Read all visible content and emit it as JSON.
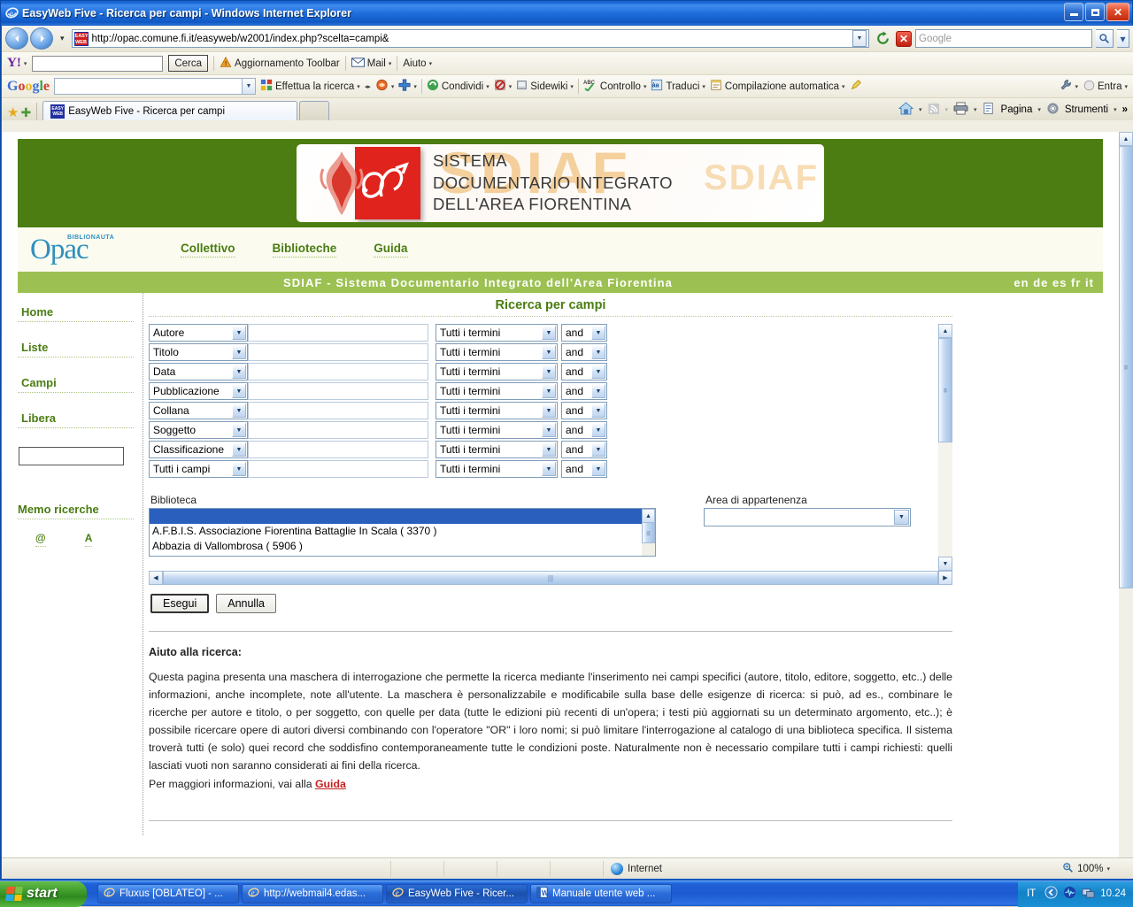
{
  "window": {
    "title": "EasyWeb Five - Ricerca per campi - Windows Internet Explorer",
    "minimize": "_",
    "maximize": "❐",
    "close": "✕"
  },
  "browser": {
    "back_icon": "◀",
    "forward_icon": "▶",
    "history_caret": "▾",
    "url": "http://opac.comune.fi.it/easyweb/w2001/index.php?scelta=campi&",
    "url_favicon_text": "EASY WEB",
    "refresh_icon": "↻",
    "stop_icon": "✕",
    "search_placeholder": "Google",
    "search_icon": "🔍",
    "search_caret": "▾"
  },
  "yahoo_toolbar": {
    "logo": "Y!",
    "caret": "▾",
    "input_value": "",
    "search_button": "Cerca",
    "items": [
      {
        "label": "Aggiornamento Toolbar",
        "icon": "warning-icon",
        "caret": false
      },
      {
        "label": "Mail",
        "icon": "mail-icon",
        "caret": true
      },
      {
        "label": "Aiuto",
        "icon": "",
        "caret": true
      }
    ]
  },
  "google_toolbar": {
    "logo": "Google",
    "input_value": "",
    "items": [
      {
        "label": "Effettua la ricerca",
        "icon": "google-search-icon",
        "caret": true
      },
      {
        "label": "",
        "icon": "bookmark-icon",
        "caret": true
      },
      {
        "label": "",
        "icon": "plus-icon",
        "caret": true
      },
      {
        "label": "Condividi",
        "icon": "share-icon",
        "caret": true
      },
      {
        "label": "",
        "icon": "blocked-icon",
        "caret": true
      },
      {
        "label": "Sidewiki",
        "icon": "sidewiki-icon",
        "caret": true
      },
      {
        "label": "Controllo",
        "icon": "spellcheck-icon",
        "caret": true
      },
      {
        "label": "Traduci",
        "icon": "translate-icon",
        "caret": true
      },
      {
        "label": "Compilazione automatica",
        "icon": "autofill-icon",
        "caret": true
      },
      {
        "label": "",
        "icon": "highlighter-icon",
        "caret": false
      }
    ],
    "right_items": [
      {
        "label": "",
        "icon": "wrench-icon",
        "caret": true
      },
      {
        "label": "Entra",
        "icon": "account-icon",
        "caret": true
      }
    ]
  },
  "tabs": {
    "favorites_icon": "★",
    "add_favorite_icon": "✚",
    "items": [
      {
        "label": "EasyWeb Five - Ricerca per campi",
        "favicon": "EASY WEB",
        "active": true
      },
      {
        "label": "",
        "favicon": "",
        "active": false
      }
    ],
    "tools": [
      {
        "label": "",
        "icon": "home-icon",
        "caret": true
      },
      {
        "label": "",
        "icon": "feed-icon",
        "caret": true
      },
      {
        "label": "",
        "icon": "print-icon",
        "caret": true
      },
      {
        "label": "Pagina",
        "icon": "page-icon",
        "caret": true
      },
      {
        "label": "Strumenti",
        "icon": "gear-icon",
        "caret": true
      }
    ],
    "overflow": "»"
  },
  "page": {
    "banner": {
      "line1": "SISTEMA",
      "line2": "DOCUMENTARIO INTEGRATO",
      "line3": "DELL'AREA FIORENTINA",
      "watermark": "SDIAF",
      "watermark2": "SDIAF",
      "crest_letters": "Œ"
    },
    "opac": {
      "logo_main": "Opac",
      "logo_sub": "BIBLIONAUTA",
      "nav": [
        "Collettivo",
        "Biblioteche",
        "Guida"
      ]
    },
    "greenstrip": {
      "title": "SDIAF - Sistema Documentario Integrato dell'Area Fiorentina",
      "languages": "en de es fr it"
    },
    "sidebar": {
      "items": [
        "Home",
        "Liste",
        "Campi",
        "Libera"
      ],
      "quick_search_value": "",
      "memo_title": "Memo ricerche",
      "memo_icons": [
        "@",
        "A"
      ]
    },
    "main": {
      "title": "Ricerca per campi",
      "rows": [
        {
          "field": "Autore",
          "value": "",
          "mode": "Tutti i termini",
          "op": "and"
        },
        {
          "field": "Titolo",
          "value": "",
          "mode": "Tutti i termini",
          "op": "and"
        },
        {
          "field": "Data",
          "value": "",
          "mode": "Tutti i termini",
          "op": "and"
        },
        {
          "field": "Pubblicazione",
          "value": "",
          "mode": "Tutti i termini",
          "op": "and"
        },
        {
          "field": "Collana",
          "value": "",
          "mode": "Tutti i termini",
          "op": "and"
        },
        {
          "field": "Soggetto",
          "value": "",
          "mode": "Tutti i termini",
          "op": "and"
        },
        {
          "field": "Classificazione",
          "value": "",
          "mode": "Tutti i termini",
          "op": "and"
        },
        {
          "field": "Tutti i campi",
          "value": "",
          "mode": "Tutti i termini",
          "op": "and"
        }
      ],
      "biblioteca_label": "Biblioteca",
      "biblioteca_options": [
        "",
        "A.F.B.I.S. Associazione Fiorentina Battaglie In Scala ( 3370 )",
        "Abbazia di Vallombrosa ( 5906 )"
      ],
      "area_label": "Area di appartenenza",
      "area_value": "",
      "buttons": {
        "submit": "Esegui",
        "reset": "Annulla"
      },
      "help_title": "Aiuto alla ricerca:",
      "help_paragraph": "Questa pagina presenta una maschera di interrogazione che permette la ricerca mediante l'inserimento nei campi specifici (autore, titolo, editore, soggetto, etc..) delle informazioni, anche incomplete, note all'utente. La maschera è personalizzabile e modificabile sulla base delle esigenze di ricerca: si può, ad es., combinare le ricerche per autore e titolo, o per soggetto, con quelle per data (tutte le edizioni più recenti di un'opera; i testi più aggiornati su un determinato argomento, etc..); è possibile ricercare opere di autori diversi combinando con l'operatore \"OR\" i loro nomi; si può limitare l'interrogazione al catalogo di una biblioteca specifica. Il sistema troverà tutti (e solo) quei record che soddisfino contemporaneamente tutte le condizioni poste. Naturalmente non è necessario compilare tutti i campi richiesti: quelli lasciati vuoti non saranno considerati ai fini della ricerca.",
      "help_more_prefix": "Per maggiori informazioni, vai alla ",
      "help_more_link": "Guida"
    }
  },
  "statusbar": {
    "zone": "Internet",
    "zone_icon": "globe-icon",
    "zoom": "100%",
    "zoom_icon": "🔍",
    "zoom_caret": "▾"
  },
  "taskbar": {
    "start": "start",
    "tasks": [
      {
        "label": "Fluxus [OBLATEO] - ...",
        "icon": "ie-icon",
        "active": false
      },
      {
        "label": "http://webmail4.edas...",
        "icon": "ie-icon",
        "active": false
      },
      {
        "label": "EasyWeb Five - Ricer...",
        "icon": "ie-icon",
        "active": true
      },
      {
        "label": "Manuale utente web ...",
        "icon": "word-icon",
        "active": false
      }
    ],
    "language": "IT",
    "tray_icons": [
      "show-hidden-icon",
      "volume-icon",
      "network-icon"
    ],
    "clock": "10.24"
  },
  "colors": {
    "green_dark": "#4b7d12",
    "green_light": "#9cc152",
    "link_green": "#4a7d12",
    "red": "#c62020",
    "title_blue": "#2f7ae8"
  }
}
